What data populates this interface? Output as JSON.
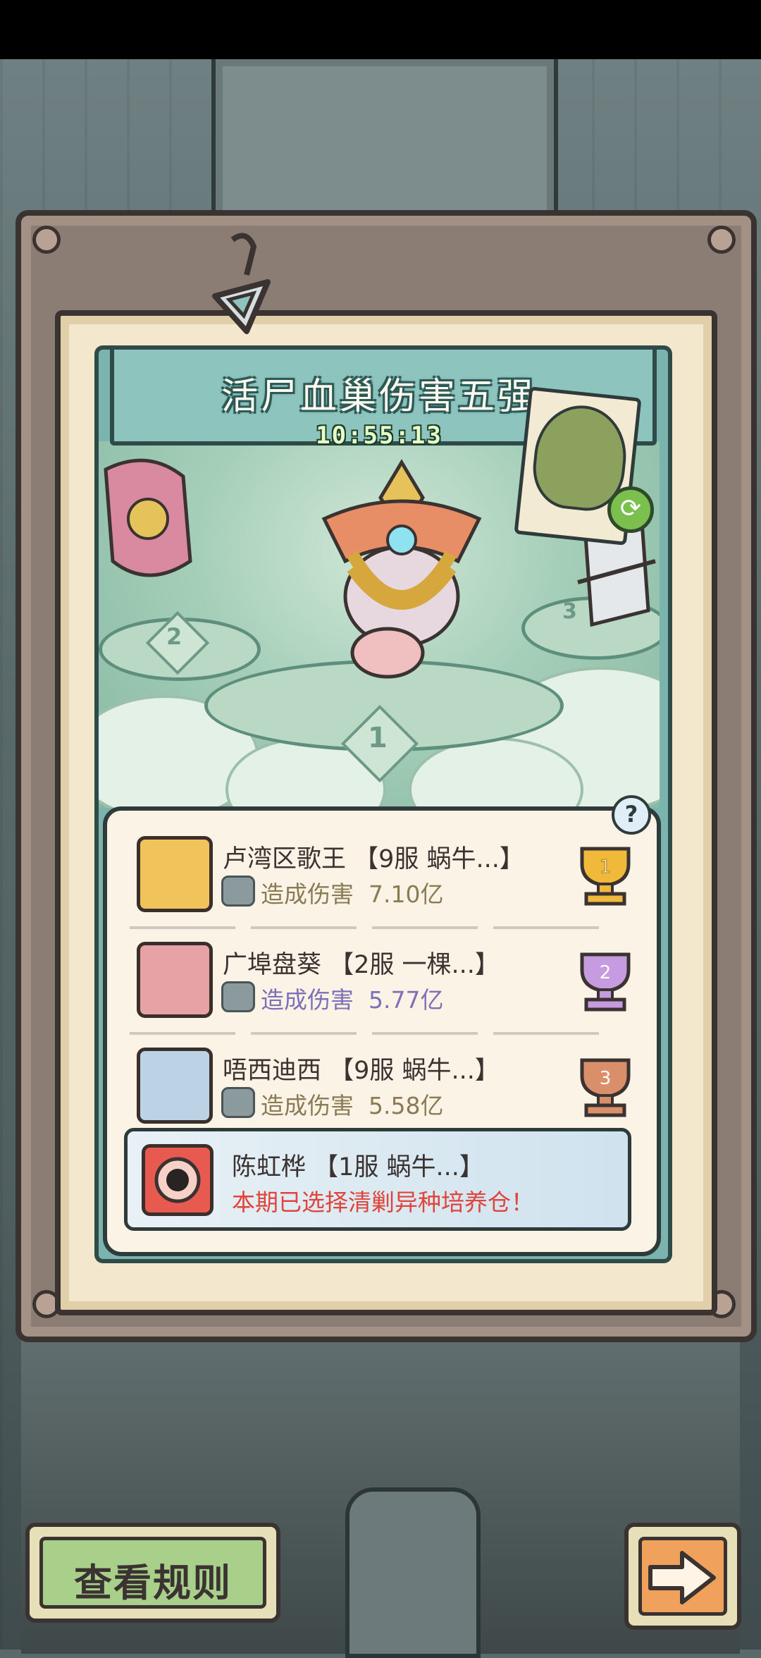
{
  "event": {
    "title": "活尸血巢伤害五强",
    "countdown": "10:55:13"
  },
  "podium": {
    "ranks": [
      "1",
      "2",
      "3"
    ]
  },
  "help": {
    "label": "?"
  },
  "leaderboard": {
    "rows": [
      {
        "rank": "1",
        "name": "卢湾区歌王 【9服  蜗牛...】",
        "damage_label": "造成伤害",
        "damage": "7.10亿",
        "damage_color": "#8a7b55",
        "trophy_color": "#f0b93a"
      },
      {
        "rank": "2",
        "name": "广埠盘葵 【2服  一棵...】",
        "damage_label": "造成伤害",
        "damage": "5.77亿",
        "damage_color": "#7d6fb8",
        "trophy_color": "#c79be0"
      },
      {
        "rank": "3",
        "name": "唔西迪西 【9服  蜗牛...】",
        "damage_label": "造成伤害",
        "damage": "5.58亿",
        "damage_color": "#8a7b55",
        "trophy_color": "#d98f6a"
      }
    ],
    "self": {
      "name": "陈虹桦 【1服  蜗牛...】",
      "status": "本期已选择清剿异种培养仓！"
    }
  },
  "buttons": {
    "rules": "查看规则",
    "next_icon": "arrow-right-icon"
  }
}
